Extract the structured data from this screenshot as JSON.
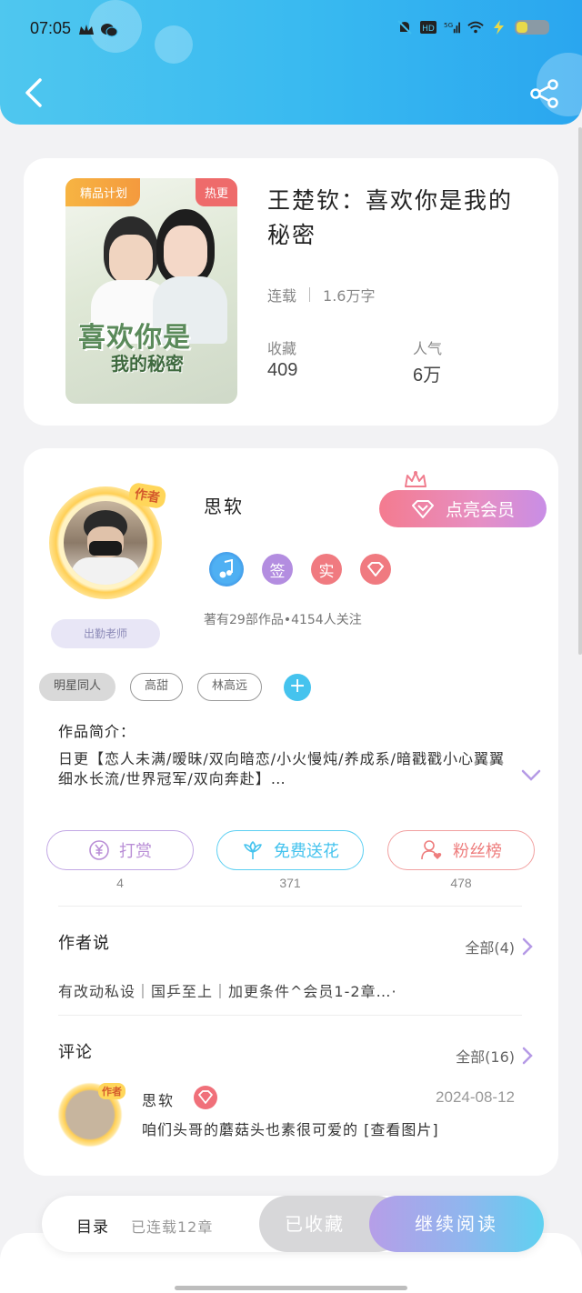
{
  "status_bar": {
    "time": "07:05"
  },
  "book": {
    "cover_tag_premium": "精品计划",
    "cover_tag_hot": "热更",
    "cover_title_line1": "喜欢你是",
    "cover_title_line2": "我的秘密",
    "title": "王楚钦：喜欢你是我的秘密",
    "status": "连载",
    "word_count": "1.6万字",
    "favorites_label": "收藏",
    "favorites_value": "409",
    "popularity_label": "人气",
    "popularity_value": "6万"
  },
  "author": {
    "avatar_badge": "作者",
    "duty_tag": "出勤老师",
    "name": "思软",
    "vip_button": "点亮会员",
    "badges": [
      "签",
      "实"
    ],
    "stats": "著有29部作品•4154人关注"
  },
  "tags": [
    "明星同人",
    "高甜",
    "林高远"
  ],
  "intro": {
    "title": "作品简介：",
    "text": "日更【恋人未满/暧昧/双向暗恋/小火慢炖/养成系/暗戳戳小心翼翼细水长流/世界冠军/双向奔赴】…"
  },
  "actions": [
    {
      "label": "打赏",
      "count": "4"
    },
    {
      "label": "免费送花",
      "count": "371"
    },
    {
      "label": "粉丝榜",
      "count": "478"
    }
  ],
  "author_says": {
    "title": "作者说",
    "more": "全部(4)",
    "text": "有改动私设｜国乒至上｜加更条件^会员1-2章…·"
  },
  "comments": {
    "title": "评论",
    "more": "全部(16)",
    "items": [
      {
        "avatar_badge": "作者",
        "name": "思软",
        "date": "2024-08-12",
        "text": "咱们头哥的蘑菇头也素很可爱的 [查看图片]"
      }
    ]
  },
  "bottom_bar": {
    "toc_label": "目录",
    "toc_status": "已连载12章",
    "favorited": "已收藏",
    "continue": "继续阅读"
  },
  "colors": {
    "header": "#38b9f0",
    "accent_purple": "#b69ee8",
    "accent_cyan": "#45c3ee",
    "vip_pink": "#f47b8f",
    "reward": "#b98ed6",
    "flower": "#45c3ee",
    "fans": "#ee7d7d"
  }
}
